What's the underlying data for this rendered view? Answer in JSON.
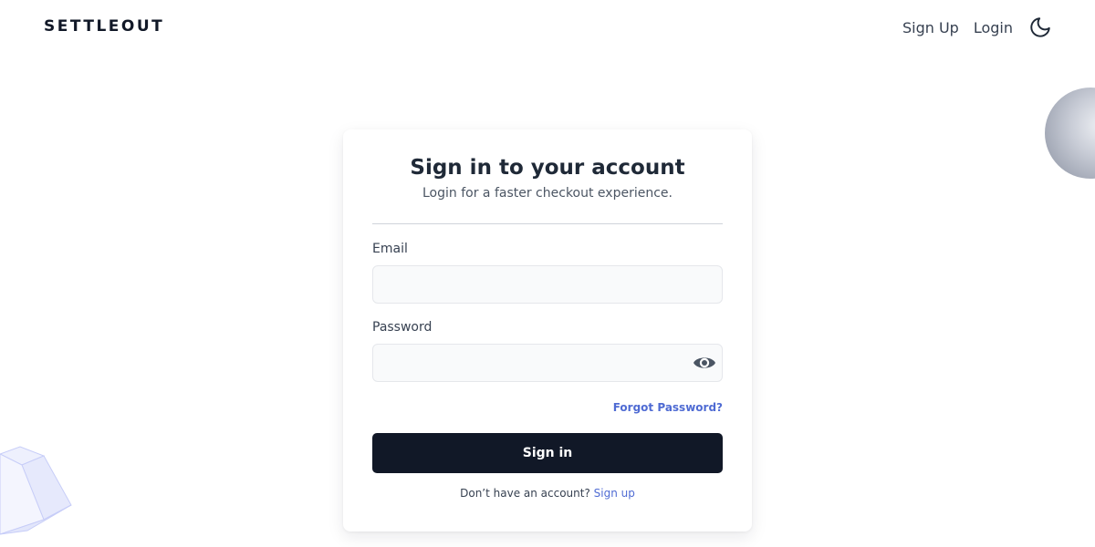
{
  "header": {
    "brand": "SETTLEOUT",
    "nav": {
      "signup_label": "Sign Up",
      "login_label": "Login"
    },
    "theme_toggle_icon": "moon-icon"
  },
  "card": {
    "title": "Sign in to your account",
    "subtitle": "Login for a faster checkout experience.",
    "email": {
      "label": "Email",
      "value": "",
      "placeholder": ""
    },
    "password": {
      "label": "Password",
      "value": "",
      "placeholder": "",
      "toggle_icon": "eye-icon"
    },
    "forgot_password": "Forgot Password?",
    "submit_label": "Sign in",
    "footer_prompt": "Don’t have an account?",
    "footer_link": "Sign up"
  },
  "colors": {
    "primary_button": "#111827",
    "link": "#4f6bd3",
    "input_bg": "#f9fafb"
  }
}
